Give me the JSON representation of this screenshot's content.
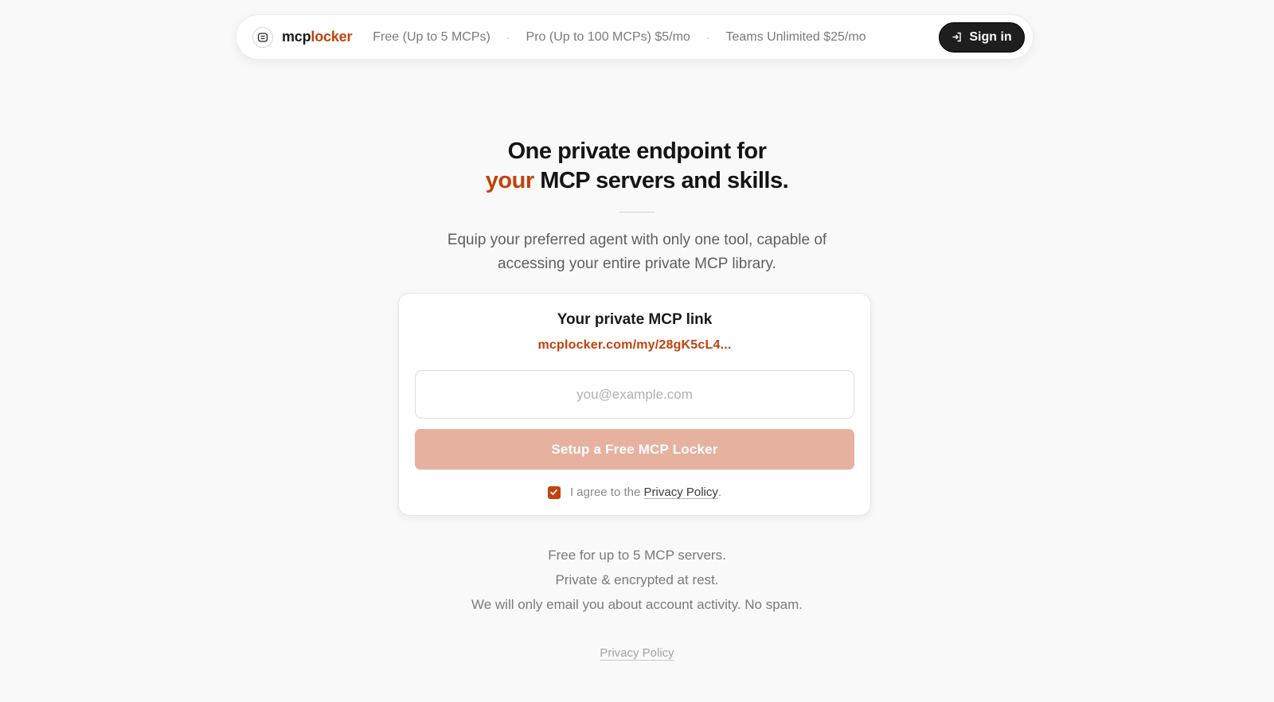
{
  "nav": {
    "brand_part1": "mcp",
    "brand_part2": "locker",
    "logo_icon": "locker-icon",
    "plans": [
      "Free (Up to 5 MCPs)",
      "Pro (Up to 100 MCPs) $5/mo",
      "Teams Unlimited $25/mo"
    ],
    "separator": "·",
    "signin_label": "Sign in",
    "signin_icon": "sign-in-icon"
  },
  "hero": {
    "headline_line1": "One private endpoint for",
    "headline_accent": "your",
    "headline_rest": " MCP servers and skills.",
    "subtitle_line1": "Equip your preferred agent with only one tool, capable of",
    "subtitle_line2": "accessing your entire private MCP library."
  },
  "card": {
    "title": "Your private MCP link",
    "link": "mcplocker.com/my/28gK5cL4...",
    "email_placeholder": "you@example.com",
    "email_value": "",
    "cta_label": "Setup a Free MCP Locker",
    "agree_prefix": "I agree to the ",
    "agree_link": "Privacy Policy",
    "agree_suffix": ".",
    "agree_checked": true
  },
  "notes": [
    "Free for up to 5 MCP servers.",
    "Private & encrypted at rest.",
    "We will only email you about account activity. No spam."
  ],
  "footer": {
    "privacy_link": "Privacy Policy"
  },
  "colors": {
    "accent": "#c2410c",
    "cta_bg": "#e6b19e",
    "signin_bg": "#1e1e1e",
    "page_bg": "#f9f9f9"
  }
}
